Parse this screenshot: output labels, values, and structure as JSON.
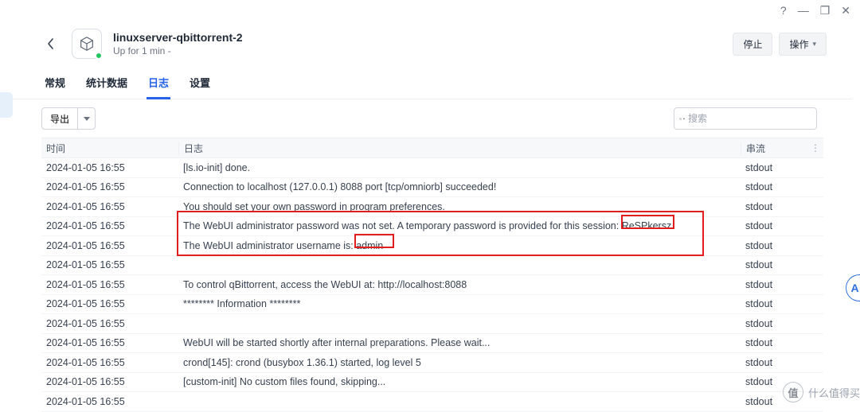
{
  "titlebar": {
    "help": "?",
    "minimize": "—",
    "maximize": "❐",
    "close": "✕"
  },
  "header": {
    "title": "linuxserver-qbittorrent-2",
    "subtitle": "Up for 1 min -",
    "stop_label": "停止",
    "actions_label": "操作"
  },
  "tabs": {
    "general": "常规",
    "stats": "统计数据",
    "logs": "日志",
    "settings": "设置"
  },
  "toolbar": {
    "export_label": "导出",
    "search_placeholder": "搜索"
  },
  "table": {
    "col_time": "时间",
    "col_log": "日志",
    "col_stream": "串流",
    "col_more": "⋮",
    "rows": [
      {
        "time": "2024-01-05 16:55",
        "log": "[ls.io-init] done.",
        "stream": "stdout"
      },
      {
        "time": "2024-01-05 16:55",
        "log": "Connection to localhost (127.0.0.1) 8088 port [tcp/omniorb] succeeded!",
        "stream": "stdout"
      },
      {
        "time": "2024-01-05 16:55",
        "log": "You should set your own password in program preferences.",
        "stream": "stdout"
      },
      {
        "time": "2024-01-05 16:55",
        "log": "The WebUI administrator password was not set. A temporary password is provided for this session: ReSPkersz",
        "stream": "stdout"
      },
      {
        "time": "2024-01-05 16:55",
        "log": "The WebUI administrator username is: admin",
        "stream": "stdout"
      },
      {
        "time": "2024-01-05 16:55",
        "log": "",
        "stream": "stdout"
      },
      {
        "time": "2024-01-05 16:55",
        "log": "To control qBittorrent, access the WebUI at: http://localhost:8088",
        "stream": "stdout"
      },
      {
        "time": "2024-01-05 16:55",
        "log": "******** Information ********",
        "stream": "stdout"
      },
      {
        "time": "2024-01-05 16:55",
        "log": "",
        "stream": "stdout"
      },
      {
        "time": "2024-01-05 16:55",
        "log": "WebUI will be started shortly after internal preparations. Please wait...",
        "stream": "stdout"
      },
      {
        "time": "2024-01-05 16:55",
        "log": "crond[145]: crond (busybox 1.36.1) started, log level 5",
        "stream": "stdout"
      },
      {
        "time": "2024-01-05 16:55",
        "log": "[custom-init] No custom files found, skipping...",
        "stream": "stdout"
      },
      {
        "time": "2024-01-05 16:55",
        "log": "",
        "stream": "stdout"
      }
    ]
  },
  "watermark": {
    "badge": "值",
    "text": "什么值得买"
  },
  "right_bubble": "A"
}
